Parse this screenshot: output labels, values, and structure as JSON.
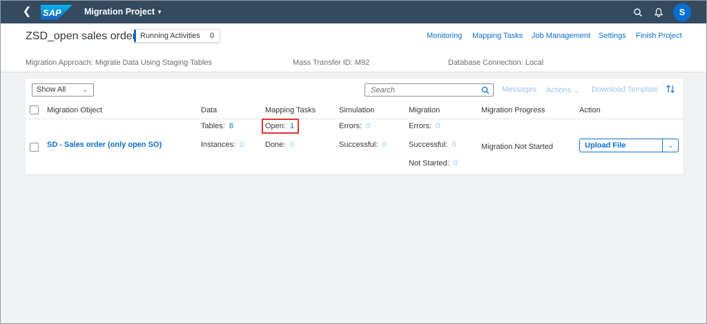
{
  "shell": {
    "logo_text": "SAP",
    "app_title": "Migration Project"
  },
  "header": {
    "page_title": "ZSD_open sales order",
    "running_label": "Running Activities",
    "running_count": "0",
    "nav": [
      "Monitoring",
      "Mapping Tasks",
      "Job Management",
      "Settings",
      "Finish Project"
    ],
    "migration_approach": "Migration Approach: Migrate Data Using Staging Tables",
    "mass_transfer": "Mass Transfer ID: M92",
    "db_connection": "Database Connection: Local"
  },
  "toolbar": {
    "filter_value": "Show All",
    "search_placeholder": "Search",
    "messages": "Messages",
    "actions": "Actions",
    "download_template": "Download Template"
  },
  "table": {
    "columns": [
      "Migration Object",
      "Data",
      "Mapping Tasks",
      "Simulation",
      "Migration",
      "Migration Progress",
      "Action"
    ],
    "row": {
      "object": "SD - Sales order (only open SO)",
      "tables_label": "Tables:",
      "tables_value": "8",
      "instances_label": "Instances:",
      "instances_value": "0",
      "open_label": "Open:",
      "open_value": "1",
      "done_label": "Done:",
      "done_value": "0",
      "sim_errors_label": "Errors:",
      "sim_errors_value": "0",
      "sim_success_label": "Successful:",
      "sim_success_value": "0",
      "mig_errors_label": "Errors:",
      "mig_errors_value": "0",
      "mig_success_label": "Successful:",
      "mig_success_value": "0",
      "mig_notstarted_label": "Not Started:",
      "mig_notstarted_value": "0",
      "progress": "Migration Not Started",
      "action_label": "Upload File"
    }
  },
  "colors": {
    "shell": "#354a5f",
    "accent": "#0a6ed1",
    "highlight": "#e03131"
  }
}
